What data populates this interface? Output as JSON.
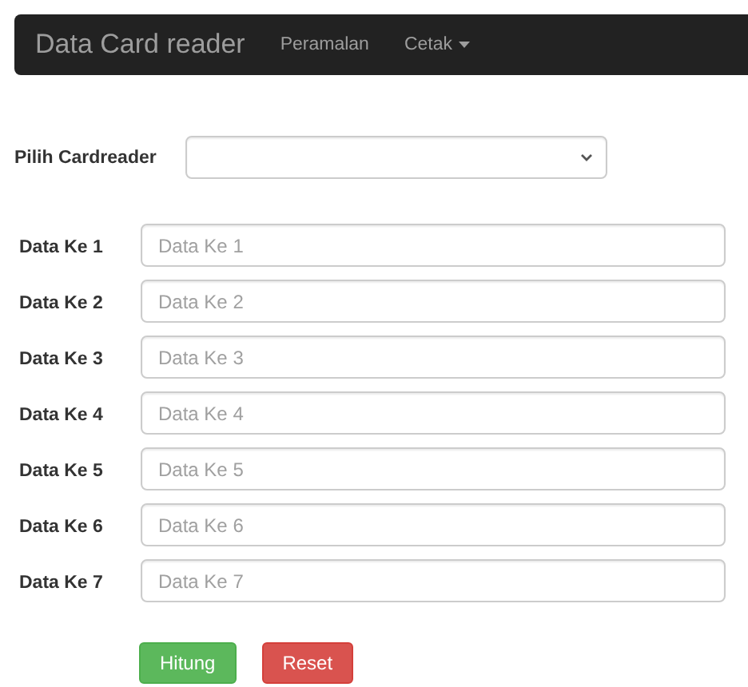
{
  "navbar": {
    "brand": "Data Card reader",
    "items": [
      {
        "label": "Peramalan",
        "dropdown": false
      },
      {
        "label": "Cetak",
        "dropdown": true
      }
    ]
  },
  "selector": {
    "label": "Pilih Cardreader"
  },
  "fields": [
    {
      "label": "Data Ke 1",
      "placeholder": "Data Ke 1"
    },
    {
      "label": "Data Ke 2",
      "placeholder": "Data Ke 2"
    },
    {
      "label": "Data Ke 3",
      "placeholder": "Data Ke 3"
    },
    {
      "label": "Data Ke 4",
      "placeholder": "Data Ke 4"
    },
    {
      "label": "Data Ke 5",
      "placeholder": "Data Ke 5"
    },
    {
      "label": "Data Ke 6",
      "placeholder": "Data Ke 6"
    },
    {
      "label": "Data Ke 7",
      "placeholder": "Data Ke 7"
    }
  ],
  "buttons": [
    {
      "label": "Hitung",
      "kind": "success"
    },
    {
      "label": "Reset",
      "kind": "danger"
    }
  ]
}
